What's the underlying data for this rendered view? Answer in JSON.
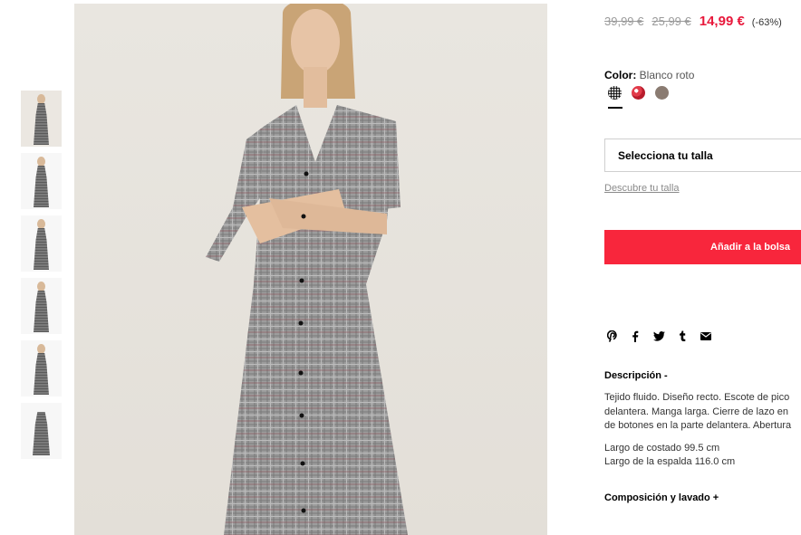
{
  "gallery": {
    "thumbnails": [
      "front-arms-crossed",
      "front-full",
      "front-full-2",
      "side",
      "detail-sleeve",
      "flat-lay"
    ]
  },
  "price": {
    "original_1": "39,99 €",
    "original_2": "25,99 €",
    "current": "14,99 €",
    "discount": "(-63%)"
  },
  "color": {
    "label": "Color:",
    "value": "Blanco roto",
    "swatches": [
      "checked-grey",
      "red-floral",
      "brown"
    ]
  },
  "size": {
    "select_label": "Selecciona tu talla",
    "guide_link": "Descubre tu talla"
  },
  "cart": {
    "add_button": "Añadir a la bolsa"
  },
  "share": {
    "icons": [
      "pinterest-icon",
      "facebook-icon",
      "twitter-icon",
      "tumblr-icon",
      "email-icon"
    ]
  },
  "description": {
    "title": "Descripción -",
    "line1": "Tejido fluido. Diseño recto. Escote de pico",
    "line2": "delantera. Manga larga. Cierre de lazo en",
    "line3": "de botones en la parte delantera. Abertura",
    "measure1": "Largo de costado 99.5 cm",
    "measure2": "Largo de la espalda 116.0 cm"
  },
  "composition": {
    "title": "Composición y lavado +"
  },
  "colors": {
    "accent": "#f8263c",
    "sale_price": "#e8193c"
  }
}
